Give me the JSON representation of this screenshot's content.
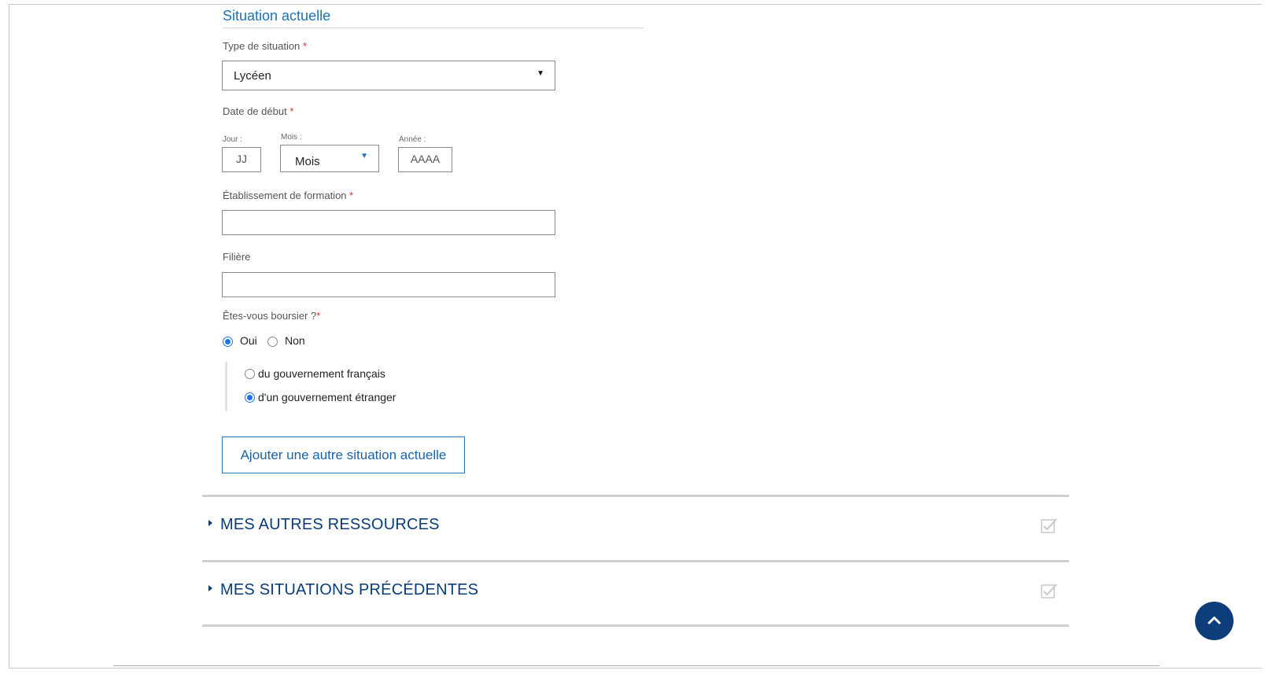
{
  "section": {
    "title": "Situation actuelle"
  },
  "situation_type": {
    "label": "Type de situation",
    "required_mark": "*",
    "value": "Lycéen"
  },
  "start_date": {
    "label": "Date de début",
    "required_mark": "*",
    "day": {
      "label": "Jour :",
      "placeholder": "JJ"
    },
    "month": {
      "label": "Mois :",
      "value": "Mois"
    },
    "year": {
      "label": "Année :",
      "placeholder": "AAAA"
    }
  },
  "institution": {
    "label": "Établissement de formation",
    "required_mark": "*",
    "value": ""
  },
  "field": {
    "label": "Filière",
    "value": ""
  },
  "scholarship": {
    "label": "Êtes-vous boursier ?",
    "required_mark": "*",
    "options": [
      {
        "label": "Oui",
        "selected": true
      },
      {
        "label": "Non",
        "selected": false
      }
    ],
    "sub_options": [
      {
        "label": "du gouvernement français",
        "selected": false
      },
      {
        "label": "d'un gouvernement étranger",
        "selected": true
      }
    ]
  },
  "add_button": {
    "label": "Ajouter une autre situation actuelle"
  },
  "accordions": [
    {
      "title": "MES AUTRES RESSOURCES"
    },
    {
      "title": "MES SITUATIONS PRÉCÉDENTES"
    }
  ],
  "colors": {
    "accent": "#1a73b5",
    "navy": "#0b3c7a",
    "radio": "#1a73e8"
  },
  "icons": {
    "accordion_arrow": "caret-right-icon",
    "status": "checkbox-checked-icon",
    "scroll_top": "chevron-up-icon"
  }
}
